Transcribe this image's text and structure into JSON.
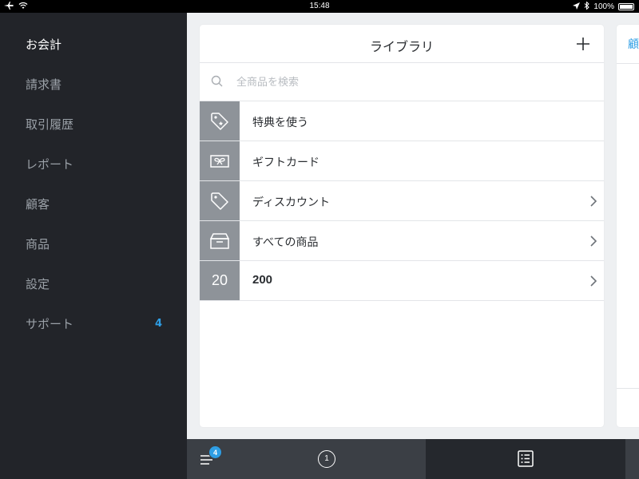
{
  "status_bar": {
    "time": "15:48",
    "battery": "100%",
    "icons": [
      "airplane-icon",
      "wifi-icon",
      "location-icon",
      "bluetooth-icon",
      "battery-icon"
    ]
  },
  "sidebar": {
    "items": [
      {
        "label": "お会計",
        "active": true
      },
      {
        "label": "請求書"
      },
      {
        "label": "取引履歴"
      },
      {
        "label": "レポート"
      },
      {
        "label": "顧客"
      },
      {
        "label": "商品"
      },
      {
        "label": "設定"
      },
      {
        "label": "サポート",
        "badge": "4"
      }
    ]
  },
  "library": {
    "title": "ライブラリ",
    "search_placeholder": "全商品を検索",
    "rows": [
      {
        "label": "特典を使う",
        "icon": "reward-tag-icon"
      },
      {
        "label": "ギフトカード",
        "icon": "gift-card-icon"
      },
      {
        "label": "ディスカウント",
        "icon": "discount-tag-icon"
      },
      {
        "label": "すべての商品",
        "icon": "item-box-icon"
      },
      {
        "label": "200",
        "thumb_text": "20"
      }
    ]
  },
  "side_card": {
    "header": "顧"
  },
  "bottom_bar": {
    "menu_badge": "4",
    "sales_count": "1"
  },
  "colors": {
    "sidebar_bg": "#222429",
    "accent": "#2e9ee5",
    "thumb_bg": "#8e9399",
    "bottom_bar_bg": "#3b3f45"
  }
}
